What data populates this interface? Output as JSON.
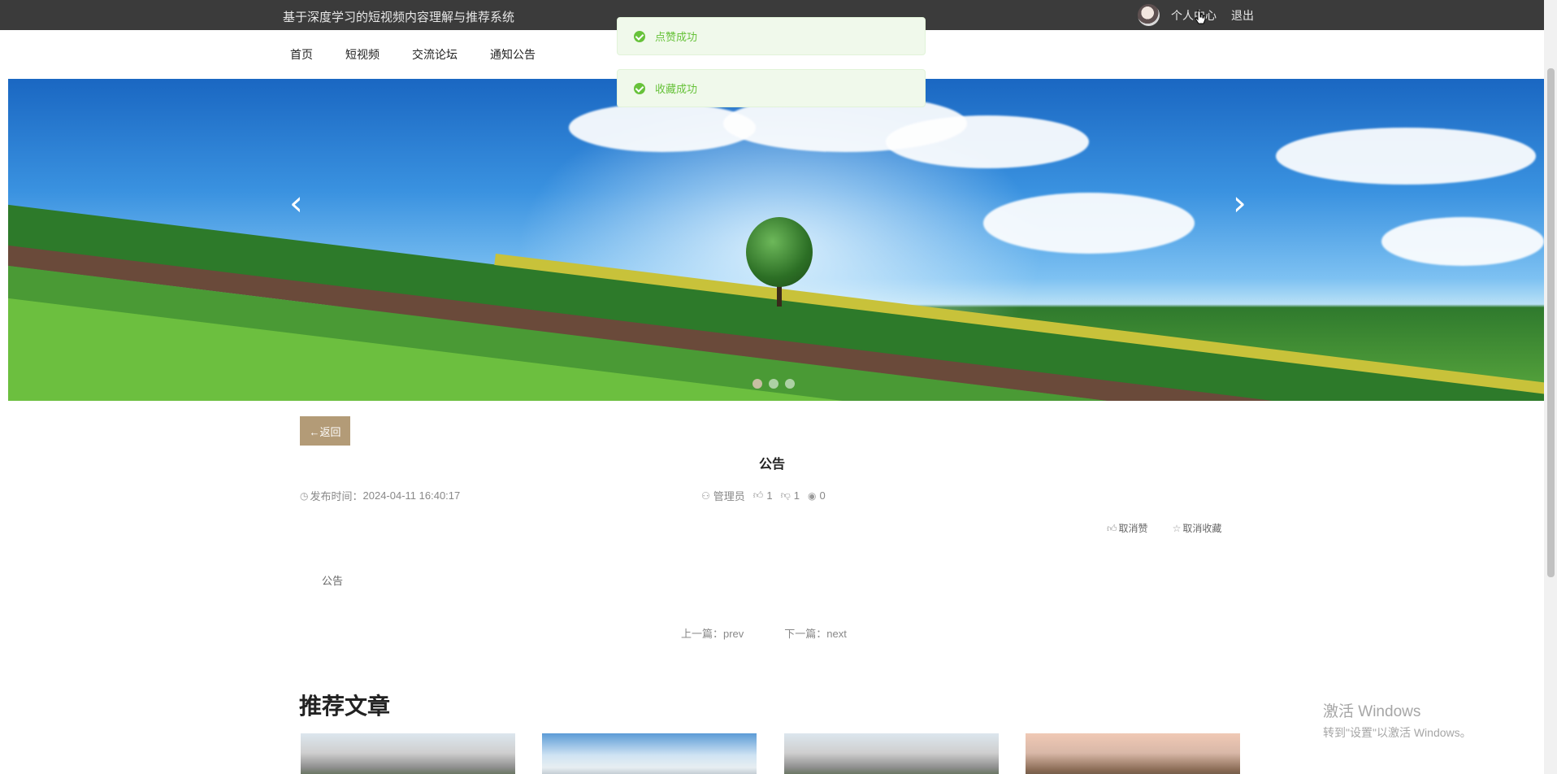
{
  "header": {
    "site_title": "基于深度学习的短视频内容理解与推荐系统",
    "user_center": "个人中心",
    "logout": "退出"
  },
  "nav": {
    "items": [
      "首页",
      "短视频",
      "交流论坛",
      "通知公告"
    ]
  },
  "toasts": [
    "点赞成功",
    "收藏成功"
  ],
  "banner": {
    "prev": "‹",
    "next": "›",
    "slide_count": 3,
    "active_slide": 1
  },
  "article": {
    "back_label": "←返回",
    "title": "公告",
    "publish_label": "发布时间：",
    "publish_time": "2024-04-11 16:40:17",
    "author": "管理员",
    "likes": "1",
    "dislikes": "1",
    "views": "0",
    "cancel_like": "取消赞",
    "cancel_favorite": "取消收藏",
    "content": "公告",
    "prev_label": "上一篇：prev",
    "next_label": "下一篇：next"
  },
  "recommend": {
    "title": "推荐文章"
  },
  "watermark": {
    "line1": "激活 Windows",
    "line2": "转到\"设置\"以激活 Windows。"
  },
  "colors": {
    "topbar": "#3b3b3b",
    "accent": "#b39b77",
    "success": "#67c23a"
  }
}
